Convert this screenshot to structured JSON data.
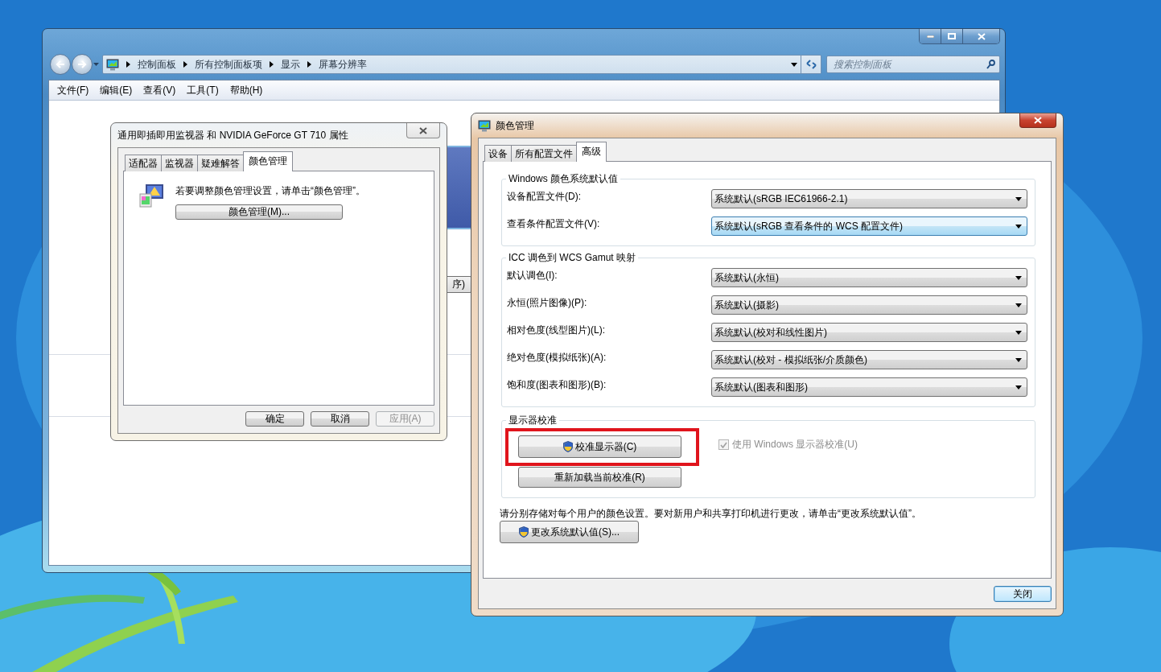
{
  "explorer": {
    "breadcrumb": [
      "控制面板",
      "所有控制面板项",
      "显示",
      "屏幕分辨率"
    ],
    "search": {
      "placeholder": "搜索控制面板"
    },
    "menu": [
      "文件(F)",
      "编辑(E)",
      "查看(V)",
      "工具(T)",
      "帮助(H)"
    ],
    "partial_button": "序)"
  },
  "properties_dialog": {
    "title": "通用即插即用监视器 和 NVIDIA GeForce GT 710 属性",
    "tabs": [
      {
        "label": "适配器",
        "selected": false
      },
      {
        "label": "监视器",
        "selected": false
      },
      {
        "label": "疑难解答",
        "selected": false
      },
      {
        "label": "颜色管理",
        "selected": true
      }
    ],
    "message": "若要调整颜色管理设置，请单击“颜色管理”。",
    "action_button": "颜色管理(M)...",
    "buttons": [
      {
        "label": "确定",
        "disabled": false
      },
      {
        "label": "取消",
        "disabled": false
      },
      {
        "label": "应用(A)",
        "disabled": true
      }
    ]
  },
  "color_dialog": {
    "title": "颜色管理",
    "tabs": [
      {
        "label": "设备",
        "selected": false
      },
      {
        "label": "所有配置文件",
        "selected": false
      },
      {
        "label": "高级",
        "selected": true
      }
    ],
    "groups": [
      {
        "title": "Windows 颜色系统默认值",
        "rows": [
          {
            "label": "设备配置文件(D):",
            "value": "系统默认(sRGB IEC61966-2.1)",
            "focused": false
          },
          {
            "label": "查看条件配置文件(V):",
            "value": "系统默认(sRGB 查看条件的 WCS 配置文件)",
            "focused": true
          }
        ]
      },
      {
        "title": "ICC 调色到 WCS Gamut 映射",
        "rows": [
          {
            "label": "默认调色(I):",
            "value": "系统默认(永恒)",
            "focused": false
          },
          {
            "label": "永恒(照片图像)(P):",
            "value": "系统默认(摄影)",
            "focused": false
          },
          {
            "label": "相对色度(线型图片)(L):",
            "value": "系统默认(校对和线性图片)",
            "focused": false
          },
          {
            "label": "绝对色度(模拟纸张)(A):",
            "value": "系统默认(校对 - 模拟纸张/介质颜色)",
            "focused": false
          },
          {
            "label": "饱和度(图表和图形)(B):",
            "value": "系统默认(图表和图形)",
            "focused": false
          }
        ]
      }
    ],
    "calibration": {
      "title": "显示器校准",
      "buttons": [
        {
          "label": "校准显示器(C)",
          "shield": true,
          "highlighted": true
        },
        {
          "label": "重新加载当前校准(R)",
          "shield": false,
          "highlighted": false
        }
      ],
      "checkbox": {
        "label": "使用 Windows 显示器校准(U)",
        "checked": true,
        "disabled": true
      }
    },
    "note": "请分别存储对每个用户的颜色设置。要对新用户和共享打印机进行更改，请单击“更改系统默认值”。",
    "defaults_button": {
      "label": "更改系统默认值(S)...",
      "shield": true
    },
    "close_button": "关闭"
  }
}
